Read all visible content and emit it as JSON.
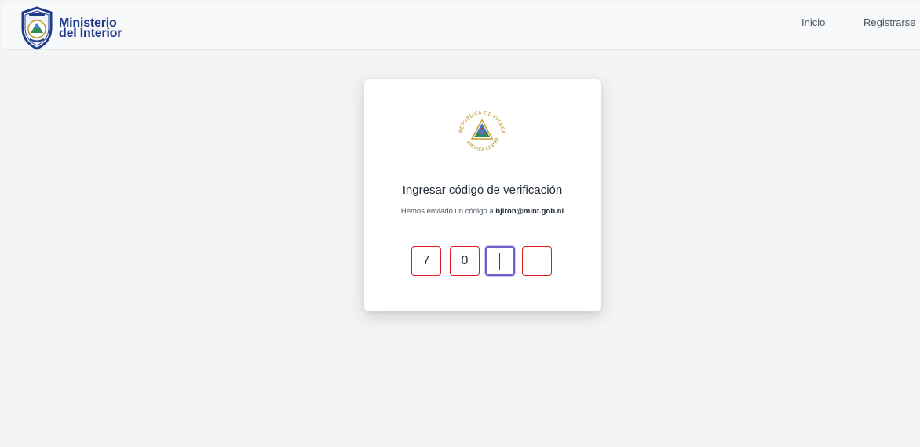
{
  "header": {
    "brand_line1": "Ministerio",
    "brand_line2": "del Interior",
    "shield_text": "MINISTERIO DEL INTERIOR",
    "nav": [
      {
        "label": "Inicio"
      },
      {
        "label": "Registrarse"
      }
    ]
  },
  "card": {
    "seal_text_top": "REPUBLICA DE NICARAGUA",
    "seal_text_bottom": "AMERICA CENTRAL",
    "title": "Ingresar código de verificación",
    "subtitle_prefix": "Hemos enviado un código a ",
    "email": "bjiron@mint.gob.ni",
    "code_digits": [
      "7",
      "0",
      "",
      ""
    ]
  },
  "colors": {
    "brand": "#1e3a8a",
    "input_border": "#e11d24",
    "focus_border": "#6d5fc7",
    "background": "#f3f4f6"
  }
}
